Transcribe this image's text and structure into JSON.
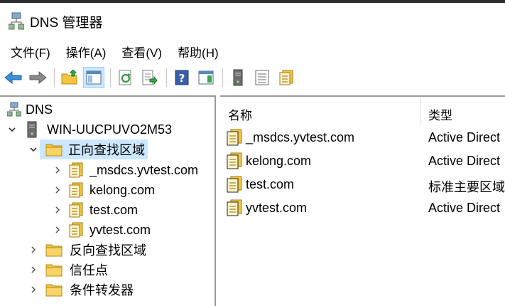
{
  "window": {
    "title": "DNS 管理器"
  },
  "menu": {
    "items": [
      {
        "label": "文件(F)"
      },
      {
        "label": "操作(A)"
      },
      {
        "label": "查看(V)"
      },
      {
        "label": "帮助(H)"
      }
    ]
  },
  "toolbar": {
    "buttons": [
      "back-icon",
      "forward-icon",
      "up-folder-icon",
      "show-hide-tree-icon",
      "refresh-icon",
      "export-list-icon",
      "help-icon",
      "action-pane-icon",
      "server-icon",
      "record-list-icon",
      "zone-icon"
    ],
    "active_button": "show-hide-tree-icon"
  },
  "tree": {
    "root": "DNS",
    "server": "WIN-UUCPUVO2M53",
    "forward_zones": "正向查找区域",
    "zones": [
      "_msdcs.yvtest.com",
      "kelong.com",
      "test.com",
      "yvtest.com"
    ],
    "reverse_zones": "反向查找区域",
    "trust_points": "信任点",
    "conditional_forwarders": "条件转发器",
    "selected": "正向查找区域"
  },
  "list": {
    "columns": {
      "name": "名称",
      "type": "类型"
    },
    "rows": [
      {
        "name": "_msdcs.yvtest.com",
        "type": "Active Direct"
      },
      {
        "name": "kelong.com",
        "type": "Active Direct"
      },
      {
        "name": "test.com",
        "type": "标准主要区域"
      },
      {
        "name": "yvtest.com",
        "type": "Active Direct"
      }
    ]
  },
  "colors": {
    "selection": "#cce8ff",
    "folder": "#f5c542",
    "toolbar_active": "#cde8ff"
  }
}
